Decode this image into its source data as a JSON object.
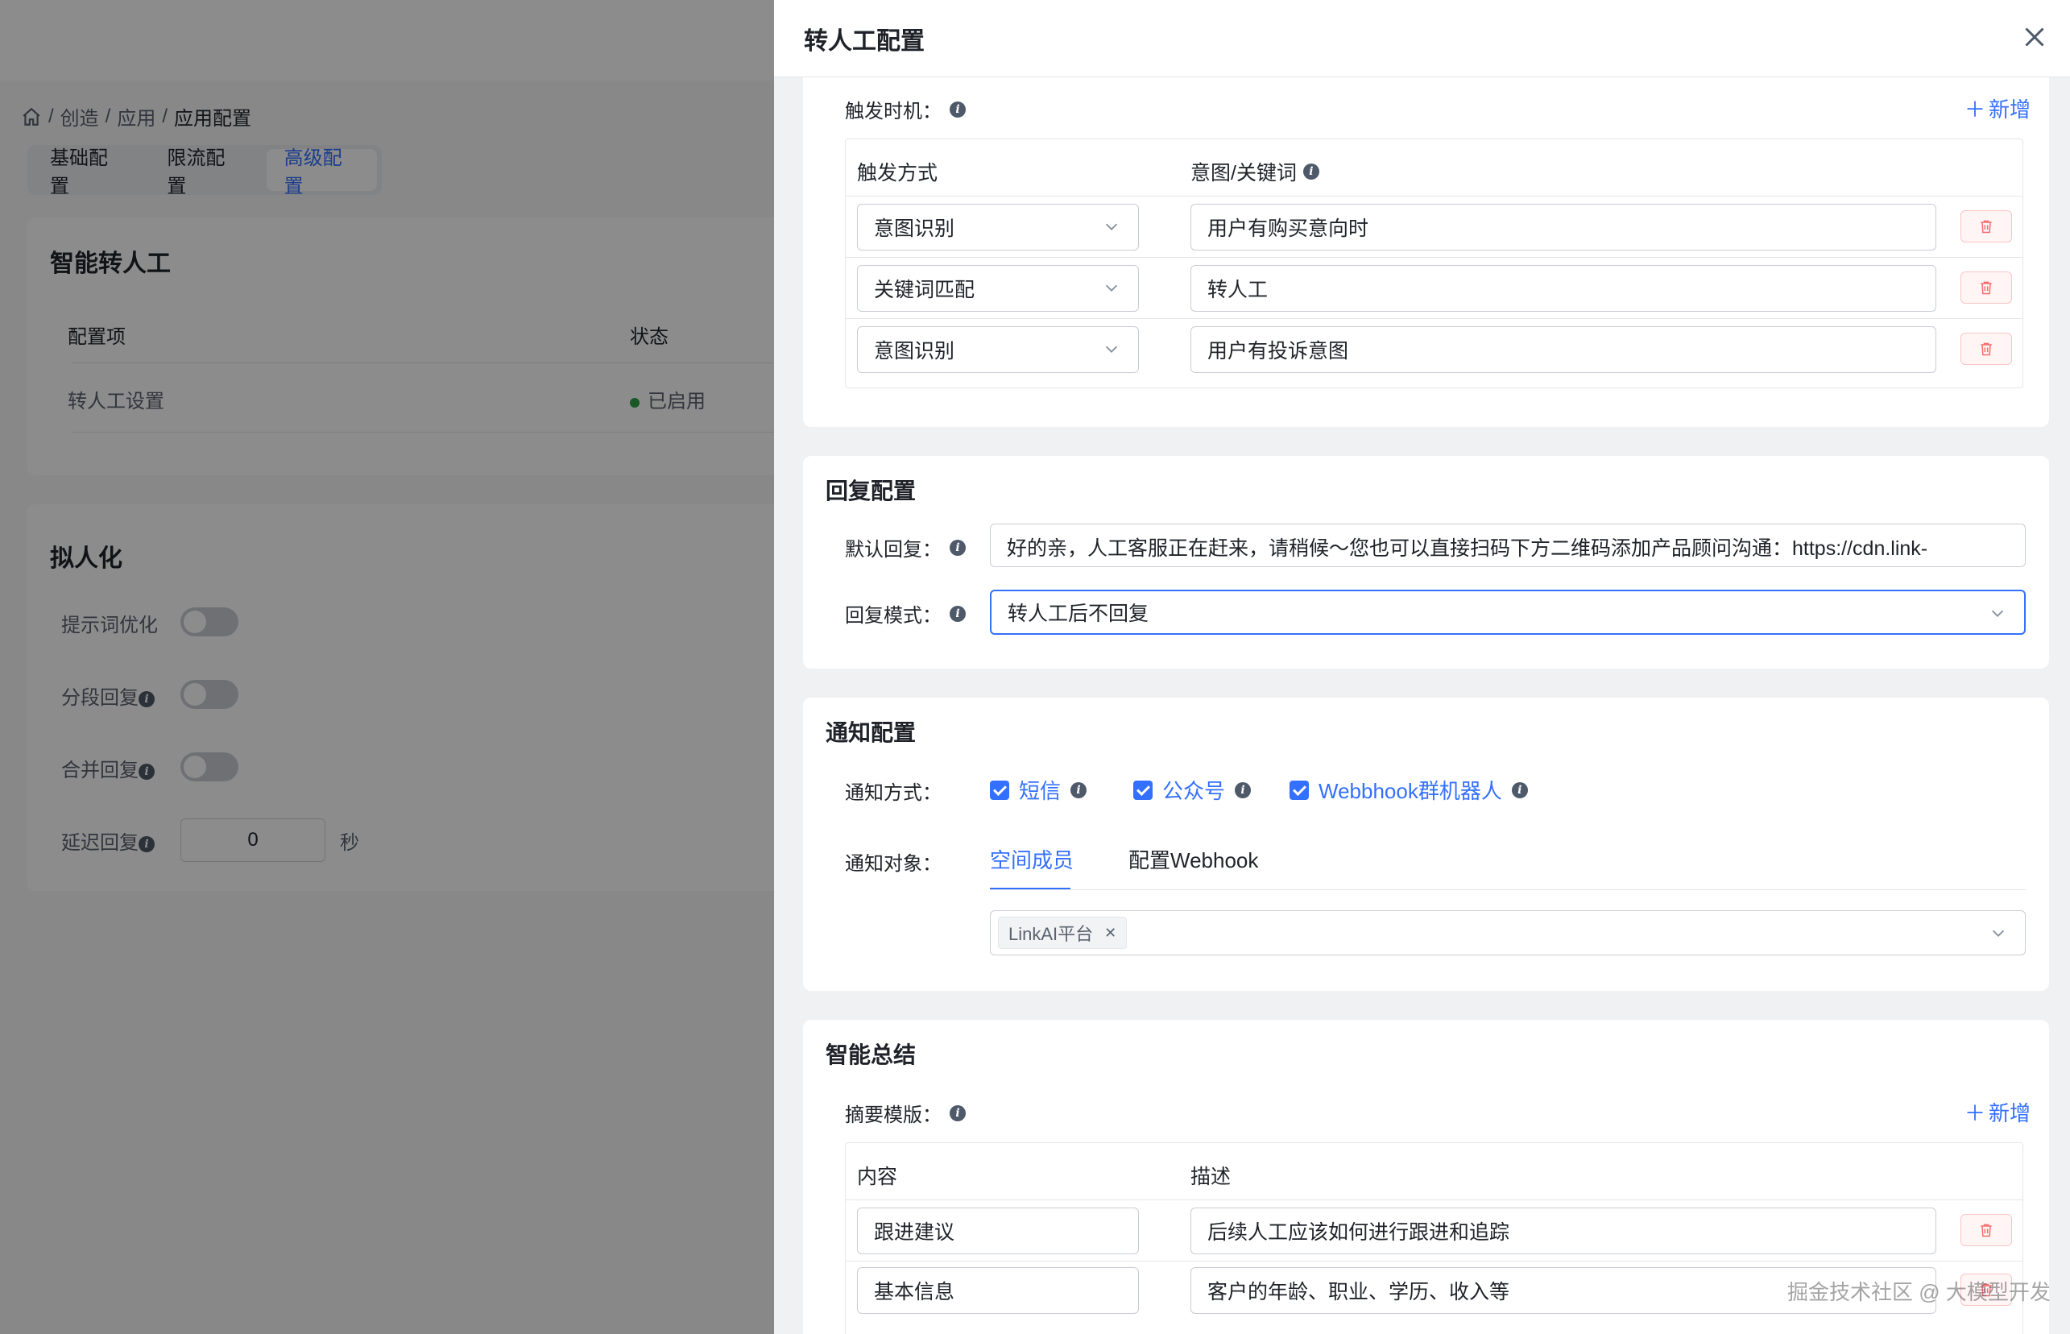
{
  "breadcrumb": {
    "sep": "/",
    "items": [
      "创造",
      "应用",
      "应用配置"
    ]
  },
  "tabs": [
    {
      "label": "基础配置"
    },
    {
      "label": "限流配置"
    },
    {
      "label": "高级配置"
    }
  ],
  "transfer_section": {
    "title": "智能转人工",
    "col_item": "配置项",
    "col_status": "状态",
    "row_item": "转人工设置",
    "row_status": "已启用"
  },
  "persona_section": {
    "title": "拟人化",
    "items": [
      {
        "label": "提示词优化",
        "enabled": false
      },
      {
        "label": "分段回复",
        "enabled": false
      },
      {
        "label": "合并回复",
        "enabled": false
      }
    ],
    "delay_label": "延迟回复",
    "delay_value": "0",
    "delay_unit": "秒"
  },
  "drawer": {
    "title": "转人工配置",
    "trigger": {
      "label": "触发时机：",
      "add": "新增",
      "col_mode": "触发方式",
      "col_intent": "意图/关键词",
      "rows": [
        {
          "mode": "意图识别",
          "value": "用户有购买意向时"
        },
        {
          "mode": "关键词匹配",
          "value": "转人工"
        },
        {
          "mode": "意图识别",
          "value": "用户有投诉意图"
        }
      ]
    },
    "reply": {
      "title": "回复配置",
      "default_label": "默认回复：",
      "default_value": "好的亲，人工客服正在赶来，请稍候～您也可以直接扫码下方二维码添加产品顾问沟通：https://cdn.link-",
      "mode_label": "回复模式：",
      "mode_value": "转人工后不回复"
    },
    "notify": {
      "title": "通知配置",
      "method_label": "通知方式：",
      "methods": [
        "短信",
        "公众号",
        "Webbhook群机器人"
      ],
      "target_label": "通知对象：",
      "subtabs": [
        "空间成员",
        "配置Webhook"
      ],
      "tag": "LinkAI平台"
    },
    "summary": {
      "title": "智能总结",
      "template_label": "摘要模版：",
      "add": "新增",
      "col_content": "内容",
      "col_desc": "描述",
      "rows": [
        {
          "content": "跟进建议",
          "desc": "后续人工应该如何进行跟进和追踪"
        },
        {
          "content": "基本信息",
          "desc": "客户的年龄、职业、学历、收入等"
        }
      ]
    }
  },
  "watermark": "掘金技术社区 @ 大模型开发",
  "colors": {
    "accent": "#3370ff",
    "danger": "#f56c6c",
    "success": "#2ea043"
  }
}
